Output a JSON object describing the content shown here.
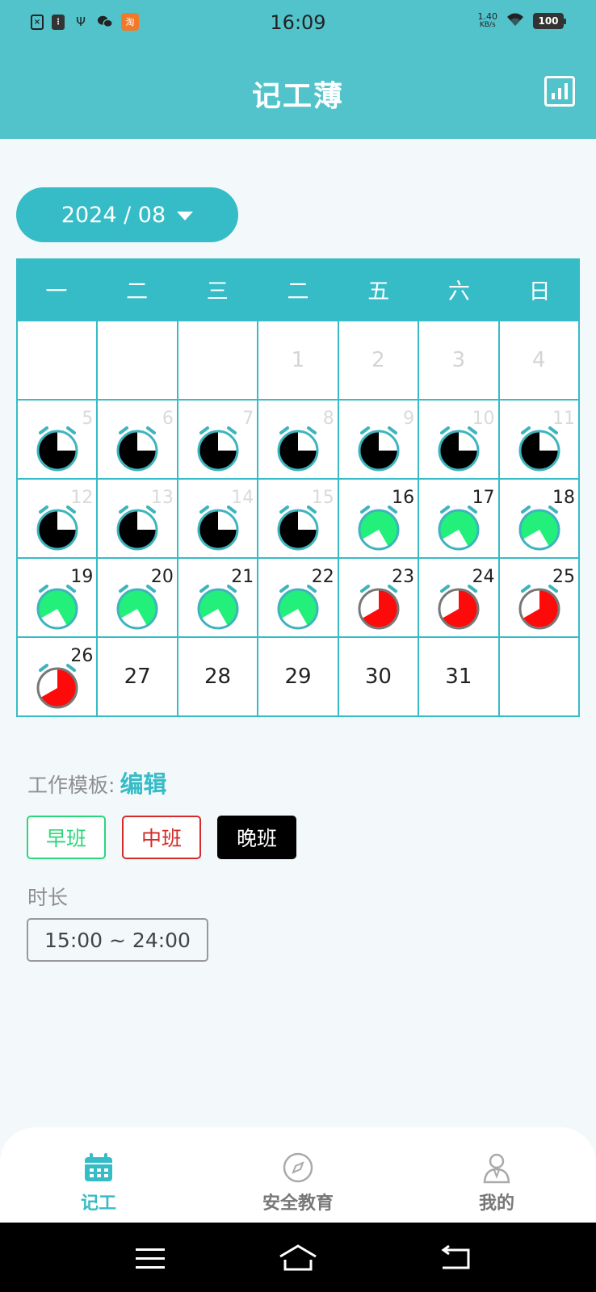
{
  "status_bar": {
    "time": "16:09",
    "net_speed_value": "1.40",
    "net_speed_unit": "KB/s",
    "battery": "100",
    "left_icons": [
      "sim-icon",
      "sim-icon-2",
      "usb-icon",
      "wechat-icon",
      "taobao-icon"
    ],
    "taobao_glyph": "淘"
  },
  "app_bar": {
    "title": "记工薄"
  },
  "month_selector": {
    "label": "2024 / 08"
  },
  "calendar": {
    "weekdays": [
      "一",
      "二",
      "三",
      "二",
      "五",
      "六",
      "日"
    ],
    "rows": [
      [
        {
          "day": "",
          "shift": null,
          "faded": false
        },
        {
          "day": "",
          "shift": null,
          "faded": false
        },
        {
          "day": "",
          "shift": null,
          "faded": false
        },
        {
          "day": "1",
          "shift": null,
          "faded": true
        },
        {
          "day": "2",
          "shift": null,
          "faded": true
        },
        {
          "day": "3",
          "shift": null,
          "faded": true
        },
        {
          "day": "4",
          "shift": null,
          "faded": true
        }
      ],
      [
        {
          "day": "5",
          "shift": "late",
          "faded": true
        },
        {
          "day": "6",
          "shift": "late",
          "faded": true
        },
        {
          "day": "7",
          "shift": "late",
          "faded": true
        },
        {
          "day": "8",
          "shift": "late",
          "faded": true
        },
        {
          "day": "9",
          "shift": "late",
          "faded": true
        },
        {
          "day": "10",
          "shift": "late",
          "faded": true
        },
        {
          "day": "11",
          "shift": "late",
          "faded": true
        }
      ],
      [
        {
          "day": "12",
          "shift": "late",
          "faded": true
        },
        {
          "day": "13",
          "shift": "late",
          "faded": true
        },
        {
          "day": "14",
          "shift": "late",
          "faded": true
        },
        {
          "day": "15",
          "shift": "late",
          "faded": true
        },
        {
          "day": "16",
          "shift": "early",
          "faded": false
        },
        {
          "day": "17",
          "shift": "early",
          "faded": false
        },
        {
          "day": "18",
          "shift": "early",
          "faded": false
        }
      ],
      [
        {
          "day": "19",
          "shift": "early",
          "faded": false
        },
        {
          "day": "20",
          "shift": "early",
          "faded": false
        },
        {
          "day": "21",
          "shift": "early",
          "faded": false
        },
        {
          "day": "22",
          "shift": "early",
          "faded": false
        },
        {
          "day": "23",
          "shift": "mid",
          "faded": false
        },
        {
          "day": "24",
          "shift": "mid",
          "faded": false
        },
        {
          "day": "25",
          "shift": "mid",
          "faded": false
        }
      ],
      [
        {
          "day": "26",
          "shift": "mid",
          "faded": false
        },
        {
          "day": "27",
          "shift": null,
          "faded": false
        },
        {
          "day": "28",
          "shift": null,
          "faded": false
        },
        {
          "day": "29",
          "shift": null,
          "faded": false
        },
        {
          "day": "30",
          "shift": null,
          "faded": false
        },
        {
          "day": "31",
          "shift": null,
          "faded": false
        },
        {
          "day": "",
          "shift": null,
          "faded": false
        }
      ]
    ]
  },
  "template": {
    "label": "工作模板:",
    "edit_label": "编辑",
    "shifts": {
      "early": "早班",
      "mid": "中班",
      "late": "晚班"
    },
    "selected_shift": "late"
  },
  "duration": {
    "label": "时长",
    "value": "15:00 ~ 24:00"
  },
  "tabs": [
    {
      "label": "记工",
      "icon": "calendar-icon",
      "active": true
    },
    {
      "label": "安全教育",
      "icon": "compass-icon",
      "active": false
    },
    {
      "label": "我的",
      "icon": "person-icon",
      "active": false
    }
  ],
  "nav_bar": {
    "icons": [
      "menu-icon",
      "home-icon",
      "back-icon"
    ]
  },
  "colors": {
    "primary": "#36bcc6",
    "header": "#52c3cb",
    "early_shift": "#22f07a",
    "mid_shift": "#ff0a0a",
    "late_shift": "#000000",
    "clock_outline": "#3eb4be"
  }
}
